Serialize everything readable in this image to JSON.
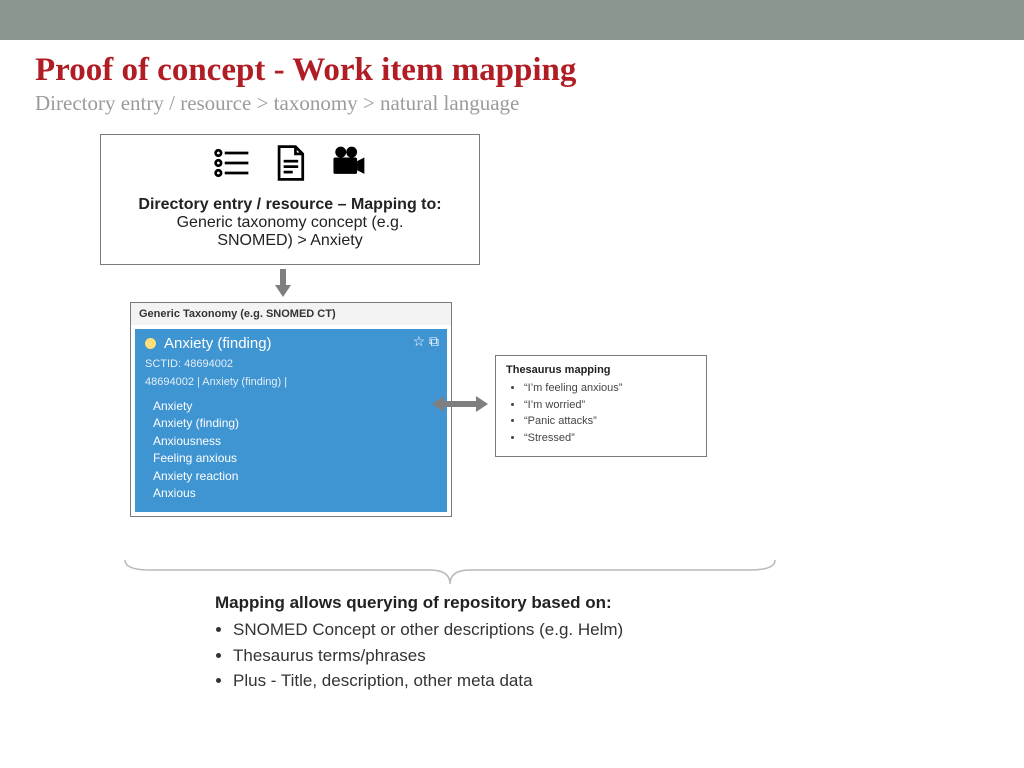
{
  "title": "Proof of concept - Work item mapping",
  "subtitle": "Directory entry / resource > taxonomy > natural language",
  "box1": {
    "heading": "Directory entry / resource – Mapping to:",
    "sub1": "Generic taxonomy concept (e.g.",
    "sub2": "SNOMED) > Anxiety"
  },
  "taxonomy": {
    "header": "Generic Taxonomy (e.g. SNOMED CT)",
    "concept_title": "Anxiety (finding)",
    "sctid": "SCTID: 48694002",
    "fqn": "48694002 | Anxiety (finding) |",
    "synonyms": [
      "Anxiety",
      "Anxiety (finding)",
      "Anxiousness",
      "Feeling anxious",
      "Anxiety reaction",
      "Anxious"
    ]
  },
  "thesaurus": {
    "heading": "Thesaurus  mapping",
    "items": [
      "“I’m feeling anxious”",
      "“I’m worried”",
      "“Panic attacks”",
      "“Stressed”"
    ]
  },
  "bottom": {
    "heading": "Mapping allows querying of repository based on:",
    "items": [
      "SNOMED Concept or other descriptions (e.g. Helm)",
      "Thesaurus terms/phrases",
      "Plus - Title, description, other meta data"
    ]
  }
}
